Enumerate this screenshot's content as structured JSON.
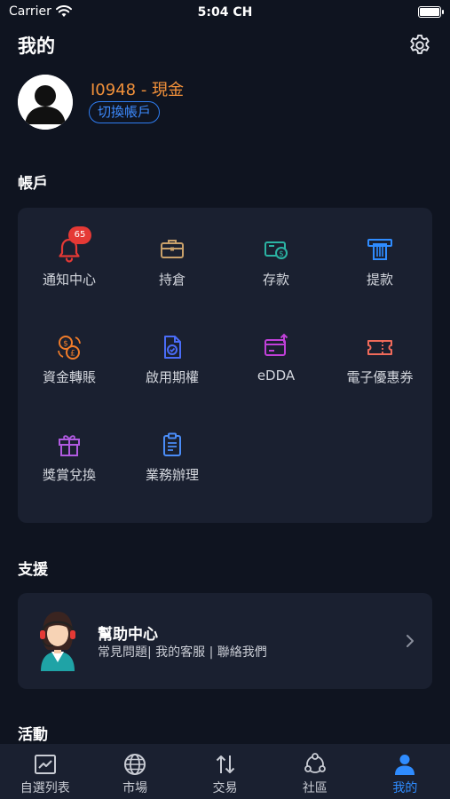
{
  "status_bar": {
    "carrier": "Carrier",
    "time": "5:04 CH"
  },
  "header": {
    "title": "我的",
    "settings_icon": "gear-icon"
  },
  "profile": {
    "account_id": "I0948 - 現金",
    "switch_label": "切換帳戶"
  },
  "account_section": {
    "title": "帳戶",
    "items": [
      {
        "label": "通知中心",
        "icon": "bell-icon",
        "badge": "65",
        "color": "#e53935"
      },
      {
        "label": "持倉",
        "icon": "briefcase-icon",
        "color": "#c8a06a"
      },
      {
        "label": "存款",
        "icon": "deposit-icon",
        "color": "#2bb3a3"
      },
      {
        "label": "提款",
        "icon": "withdraw-icon",
        "color": "#2f8cff"
      },
      {
        "label": "資金轉賬",
        "icon": "currency-exchange-icon",
        "color": "#f07c2a"
      },
      {
        "label": "啟用期權",
        "icon": "document-check-icon",
        "color": "#4a6cf7"
      },
      {
        "label": "eDDA",
        "icon": "card-upload-icon",
        "color": "#c040d8"
      },
      {
        "label": "電子優惠券",
        "icon": "ticket-icon",
        "color": "#f06a5a"
      },
      {
        "label": "獎賞兌換",
        "icon": "gift-icon",
        "color": "#b05ae0"
      },
      {
        "label": "業務辦理",
        "icon": "clipboard-icon",
        "color": "#4a8cf7"
      }
    ]
  },
  "support_section": {
    "title": "支援",
    "help_title": "幫助中心",
    "help_subtitle": "常見問題| 我的客服 | 聯絡我們"
  },
  "activity_section": {
    "title": "活動"
  },
  "tabbar": {
    "tabs": [
      {
        "label": "自選列表",
        "icon": "chart-icon"
      },
      {
        "label": "市場",
        "icon": "globe-icon"
      },
      {
        "label": "交易",
        "icon": "swap-arrows-icon"
      },
      {
        "label": "社區",
        "icon": "community-icon"
      },
      {
        "label": "我的",
        "icon": "person-icon",
        "active": true
      }
    ],
    "active_color": "#2f8cff"
  }
}
